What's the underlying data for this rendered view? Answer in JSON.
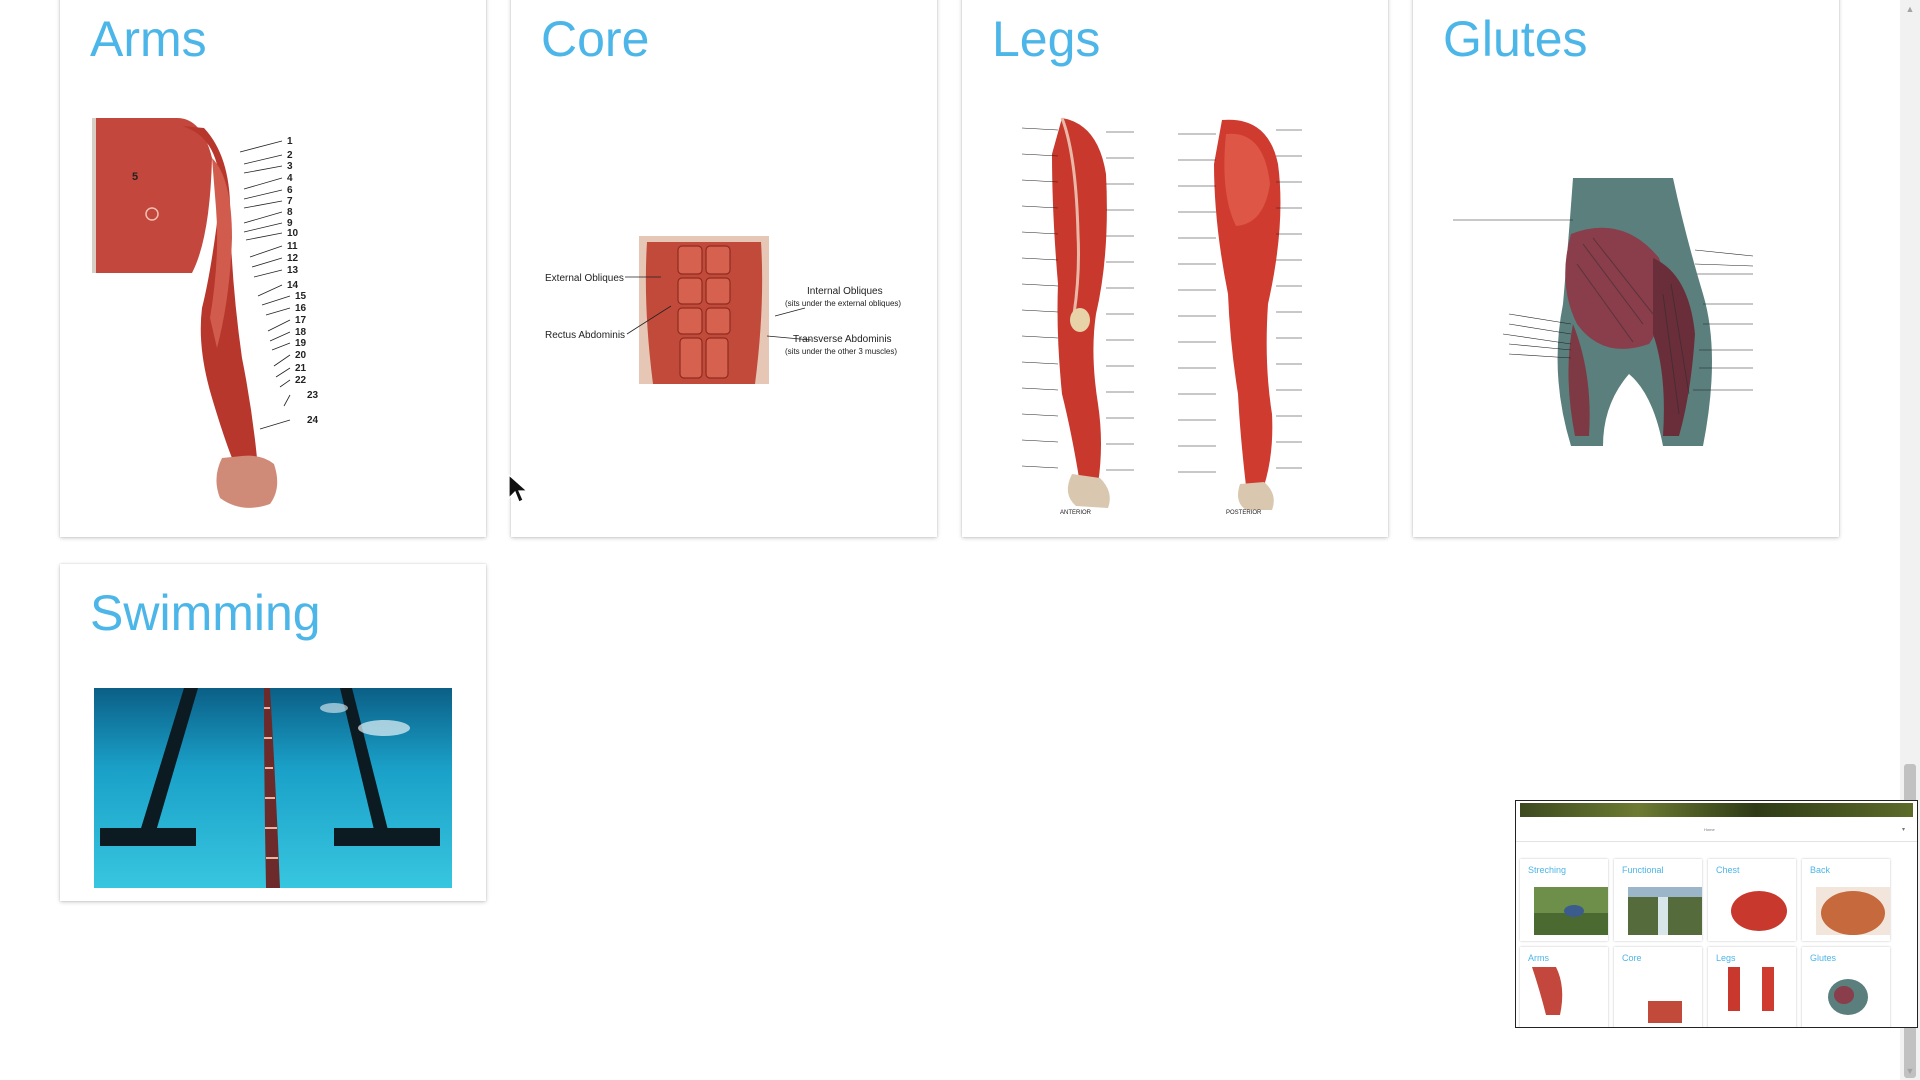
{
  "cards": [
    {
      "id": "arms",
      "title": "Arms",
      "figure": "arm-muscle-diagram",
      "labels": [
        "1",
        "2",
        "3",
        "4",
        "6",
        "7",
        "8",
        "9",
        "10",
        "11",
        "12",
        "13",
        "14",
        "15",
        "16",
        "17",
        "18",
        "19",
        "20",
        "21",
        "22",
        "23",
        "24"
      ],
      "inset_label": "5"
    },
    {
      "id": "core",
      "title": "Core",
      "figure": "abdominal-muscle-diagram",
      "labels": {
        "external_obliques": "External Obliques",
        "rectus_abdominis": "Rectus Abdominis",
        "internal_obliques": "Internal Obliques",
        "internal_obliques_note": "(sits under the external obliques)",
        "transverse_abdominis": "Transverse Abdominis",
        "transverse_abdominis_note": "(sits under the other 3 muscles)"
      }
    },
    {
      "id": "legs",
      "title": "Legs",
      "figure": "leg-muscle-diagram",
      "view_labels": {
        "anterior": "ANTERIOR",
        "posterior": "POSTERIOR"
      }
    },
    {
      "id": "glutes",
      "title": "Glutes",
      "figure": "glute-muscle-diagram"
    },
    {
      "id": "swimming",
      "title": "Swimming",
      "figure": "swimming-pool-photo"
    }
  ],
  "preview": {
    "dropdown_label": "Home",
    "cards": [
      {
        "title": "Streching"
      },
      {
        "title": "Functional"
      },
      {
        "title": "Chest"
      },
      {
        "title": "Back"
      },
      {
        "title": "Arms"
      },
      {
        "title": "Core"
      },
      {
        "title": "Legs"
      },
      {
        "title": "Glutes"
      }
    ]
  },
  "colors": {
    "title": "#4db6e8",
    "muscle": "#c8382c",
    "water": "#1fa8c9"
  },
  "icons": {
    "scroll_up": "scroll-up-arrow-icon",
    "scroll_down": "scroll-down-arrow-icon",
    "cursor": "mouse-cursor-icon"
  }
}
